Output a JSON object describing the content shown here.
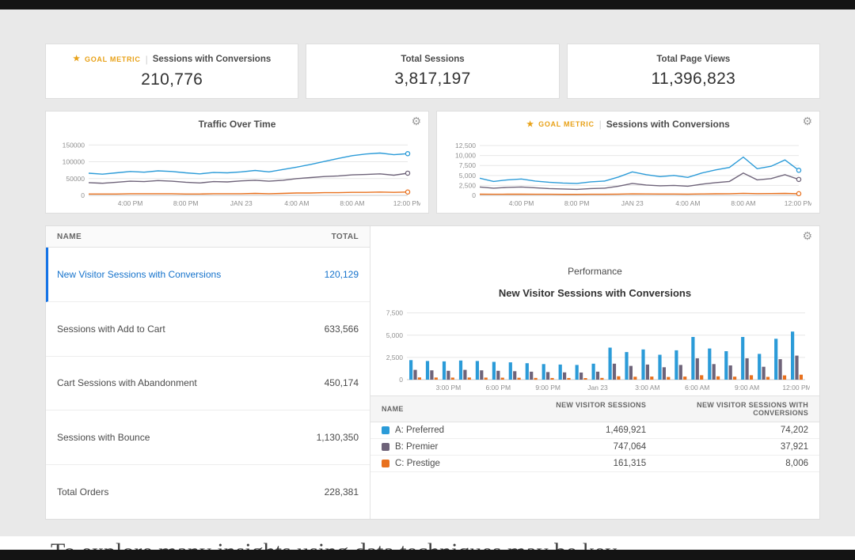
{
  "icons": {
    "gear": "⚙",
    "goal_star": "★"
  },
  "colors": {
    "accent_blue": "#1473e6",
    "series_blue": "#2b9bd8",
    "series_purple": "#6e6379",
    "series_orange": "#e8701d",
    "goal_orange": "#e8a117",
    "background": "#e9e9e9"
  },
  "kpi_cards": [
    {
      "goal_label": "GOAL METRIC",
      "label": "Sessions with Conversions",
      "value": "210,776"
    },
    {
      "label": "Total Sessions",
      "value": "3,817,197"
    },
    {
      "label": "Total Page Views",
      "value": "11,396,823"
    }
  ],
  "chart_data": [
    {
      "id": "traffic-over-time",
      "type": "line",
      "title": "Traffic Over Time",
      "ylim": [
        0,
        160000
      ],
      "y_tick_values": [
        0,
        50000,
        100000,
        150000
      ],
      "y_tick_labels": [
        "0",
        "50000",
        "100000",
        "150000"
      ],
      "x_ticks": [
        "4:00 PM",
        "8:00 PM",
        "JAN 23",
        "4:00 AM",
        "8:00 AM",
        "12:00 PM"
      ],
      "x_tick_indices": [
        3,
        7,
        11,
        15,
        19,
        23
      ],
      "grid": true,
      "legend": "none",
      "series": [
        {
          "name": "series-blue",
          "color": "#2b9bd8",
          "values": [
            66000,
            63000,
            67000,
            71000,
            69000,
            73000,
            71000,
            67000,
            64000,
            68000,
            67000,
            70000,
            74000,
            70000,
            77000,
            84000,
            92000,
            101000,
            110000,
            118000,
            123000,
            126000,
            121000,
            124000
          ]
        },
        {
          "name": "series-purple",
          "color": "#6e6379",
          "values": [
            38000,
            36000,
            39000,
            42000,
            41000,
            44000,
            42000,
            39000,
            37000,
            41000,
            40000,
            43000,
            45000,
            42000,
            45000,
            50000,
            53000,
            56000,
            58000,
            61000,
            62000,
            64000,
            60000,
            66000
          ]
        },
        {
          "name": "series-orange",
          "color": "#e8701d",
          "values": [
            4000,
            4000,
            4000,
            5000,
            5000,
            5000,
            5000,
            4000,
            4000,
            5000,
            5000,
            5000,
            6000,
            5000,
            6000,
            7000,
            7000,
            8000,
            8000,
            9000,
            9000,
            10000,
            9000,
            10000
          ]
        }
      ]
    },
    {
      "id": "sessions-with-conversions",
      "type": "line",
      "goal_label": "GOAL METRIC",
      "title": "Sessions with Conversions",
      "ylim": [
        0,
        13500
      ],
      "y_tick_values": [
        0,
        2500,
        5000,
        7500,
        10000,
        12500
      ],
      "y_tick_labels": [
        "0",
        "2,500",
        "5,000",
        "7,500",
        "10,000",
        "12,500"
      ],
      "x_ticks": [
        "4:00 PM",
        "8:00 PM",
        "JAN 23",
        "4:00 AM",
        "8:00 AM",
        "12:00 PM"
      ],
      "x_tick_indices": [
        3,
        7,
        11,
        15,
        19,
        23
      ],
      "grid": true,
      "legend": "none",
      "series": [
        {
          "name": "series-blue",
          "color": "#2b9bd8",
          "values": [
            4300,
            3500,
            3900,
            4100,
            3600,
            3300,
            3100,
            3000,
            3400,
            3600,
            4600,
            5900,
            5200,
            4700,
            5000,
            4500,
            5600,
            6400,
            7000,
            9600,
            6700,
            7300,
            8900,
            6300
          ]
        },
        {
          "name": "series-purple",
          "color": "#6e6379",
          "values": [
            2100,
            1800,
            2000,
            2100,
            1900,
            1700,
            1600,
            1500,
            1700,
            1800,
            2300,
            3000,
            2600,
            2400,
            2500,
            2300,
            2800,
            3200,
            3500,
            5600,
            3900,
            4200,
            5200,
            4000
          ]
        },
        {
          "name": "series-orange",
          "color": "#e8701d",
          "values": [
            300,
            280,
            290,
            300,
            280,
            270,
            260,
            250,
            270,
            280,
            320,
            380,
            350,
            330,
            340,
            320,
            360,
            400,
            420,
            520,
            430,
            450,
            500,
            420
          ]
        }
      ]
    },
    {
      "id": "performance-bars",
      "type": "bar",
      "panel_title": "Performance",
      "title": "New Visitor Sessions with Conversions",
      "ylim": [
        0,
        8000
      ],
      "y_tick_values": [
        0,
        2500,
        5000,
        7500
      ],
      "y_tick_labels": [
        "0",
        "2,500",
        "5,000",
        "7,500"
      ],
      "x_ticks": [
        "3:00 PM",
        "6:00 PM",
        "9:00 PM",
        "Jan 23",
        "3:00 AM",
        "6:00 AM",
        "9:00 AM",
        "12:00 PM"
      ],
      "x_tick_indices": [
        2,
        5,
        8,
        11,
        14,
        17,
        20,
        23
      ],
      "grid": true,
      "legend": "table-below",
      "series": [
        {
          "name": "A: Preferred",
          "color": "#2b9bd8",
          "values": [
            2200,
            2100,
            2050,
            2150,
            2100,
            2000,
            1950,
            1850,
            1750,
            1700,
            1650,
            1800,
            3600,
            3100,
            3400,
            2800,
            3300,
            4800,
            3500,
            3200,
            4800,
            2900,
            4600,
            5400
          ]
        },
        {
          "name": "B: Premier",
          "color": "#6e6379",
          "values": [
            1100,
            1050,
            1000,
            1100,
            1050,
            1000,
            950,
            900,
            850,
            820,
            800,
            900,
            1800,
            1550,
            1700,
            1400,
            1650,
            2400,
            1750,
            1600,
            2400,
            1450,
            2300,
            2700
          ]
        },
        {
          "name": "C: Prestige",
          "color": "#e8701d",
          "values": [
            250,
            240,
            230,
            240,
            230,
            220,
            210,
            200,
            190,
            185,
            180,
            200,
            380,
            330,
            350,
            300,
            350,
            500,
            370,
            340,
            500,
            310,
            480,
            560
          ]
        }
      ]
    }
  ],
  "metric_table": {
    "headers": [
      "NAME",
      "TOTAL"
    ],
    "rows": [
      {
        "name": "New Visitor Sessions with Conversions",
        "total": "120,129",
        "selected": true
      },
      {
        "name": "Sessions with Add to Cart",
        "total": "633,566"
      },
      {
        "name": "Cart Sessions with Abandonment",
        "total": "450,174"
      },
      {
        "name": "Sessions with Bounce",
        "total": "1,130,350"
      },
      {
        "name": "Total Orders",
        "total": "228,381"
      }
    ]
  },
  "segment_table": {
    "headers": [
      "NAME",
      "NEW VISITOR SESSIONS",
      "NEW VISITOR SESSIONS WITH CONVERSIONS"
    ],
    "rows": [
      {
        "name": "A: Preferred",
        "color": "#2b9bd8",
        "sessions": "1,469,921",
        "conversions": "74,202"
      },
      {
        "name": "B: Premier",
        "color": "#6e6379",
        "sessions": "747,064",
        "conversions": "37,921"
      },
      {
        "name": "C: Prestige",
        "color": "#e8701d",
        "sessions": "161,315",
        "conversions": "8,006"
      }
    ]
  },
  "footer": {
    "partial_text": "To explore many insights using data techniques may be key"
  }
}
